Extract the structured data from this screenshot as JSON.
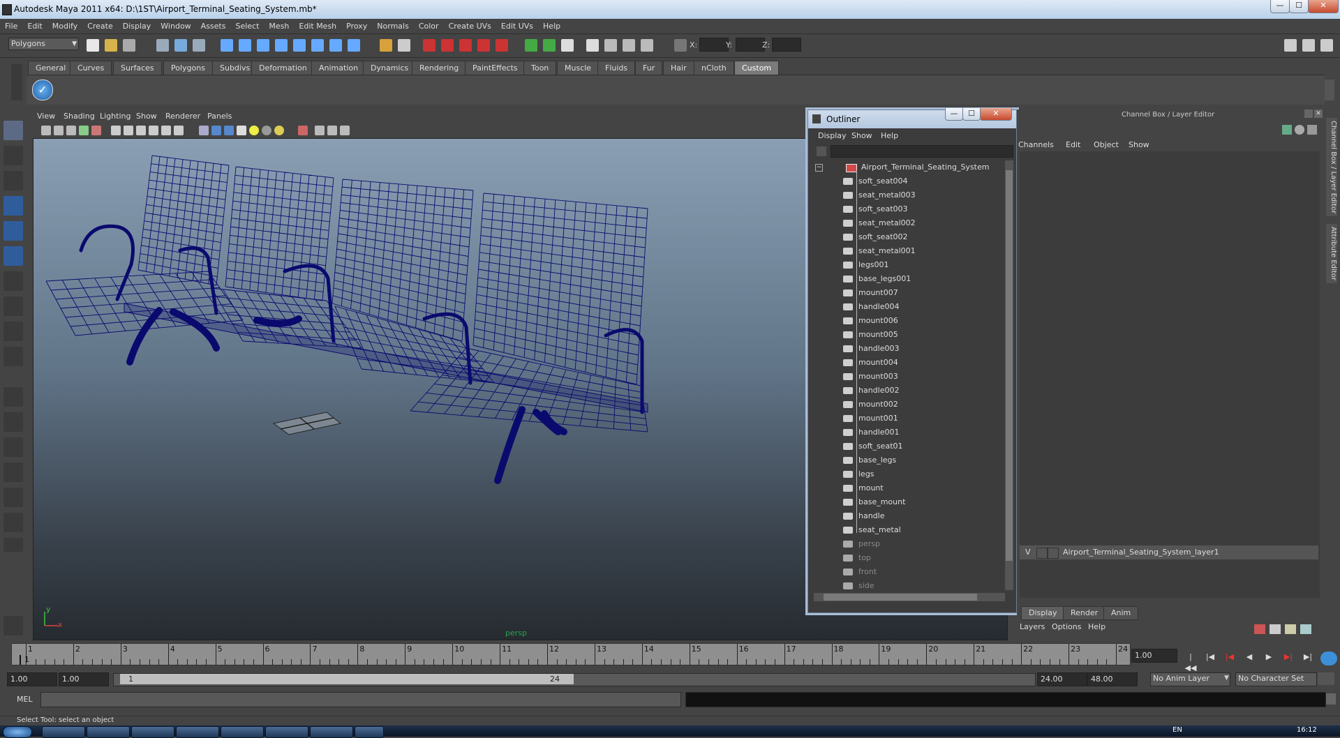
{
  "window": {
    "title": "Autodesk Maya 2011 x64: D:\\1ST\\Airport_Terminal_Seating_System.mb*",
    "min": "—",
    "max": "☐",
    "close": "✕"
  },
  "menubar": [
    "File",
    "Edit",
    "Modify",
    "Create",
    "Display",
    "Window",
    "Assets",
    "Select",
    "Mesh",
    "Edit Mesh",
    "Proxy",
    "Normals",
    "Color",
    "Create UVs",
    "Edit UVs",
    "Help"
  ],
  "statusline": {
    "mode": "Polygons",
    "x_label": "X:",
    "y_label": "Y:",
    "z_label": "Z:"
  },
  "shelf": {
    "tabs": [
      "General",
      "Curves",
      "Surfaces",
      "Polygons",
      "Subdivs",
      "Deformation",
      "Animation",
      "Dynamics",
      "Rendering",
      "PaintEffects",
      "Toon",
      "Muscle",
      "Fluids",
      "Fur",
      "Hair",
      "nCloth",
      "Custom"
    ],
    "active": "Custom"
  },
  "viewport": {
    "menu": [
      "View",
      "Shading",
      "Lighting",
      "Show",
      "Renderer",
      "Panels"
    ],
    "camera_label": "persp",
    "axis_x": "x",
    "axis_y": "y",
    "wire_color": "#0a0a6e"
  },
  "outliner": {
    "title": "Outliner",
    "menu": [
      "Display",
      "Show",
      "Help"
    ],
    "root": "Airport_Terminal_Seating_System",
    "children": [
      "soft_seat004",
      "seat_metal003",
      "soft_seat003",
      "seat_metal002",
      "soft_seat002",
      "seat_metal001",
      "legs001",
      "base_legs001",
      "mount007",
      "handle004",
      "mount006",
      "mount005",
      "handle003",
      "mount004",
      "mount003",
      "handle002",
      "mount002",
      "mount001",
      "handle001",
      "soft_seat01",
      "base_legs",
      "legs",
      "mount",
      "base_mount",
      "handle",
      "seat_metal"
    ],
    "cameras": [
      "persp",
      "top",
      "front",
      "side"
    ]
  },
  "channelbox": {
    "header": "Channel Box / Layer Editor",
    "menu": [
      "Channels",
      "Edit",
      "Object",
      "Show"
    ],
    "side_tabs": [
      "Channel Box / Layer Editor",
      "Attribute Editor"
    ]
  },
  "layereditor": {
    "tabs": [
      "Display",
      "Render",
      "Anim"
    ],
    "active_tab": "Display",
    "menu": [
      "Layers",
      "Options",
      "Help"
    ],
    "layer": {
      "visible": "V",
      "name": "Airport_Terminal_Seating_System_layer1"
    }
  },
  "timeline": {
    "ticks": [
      "1",
      "2",
      "3",
      "4",
      "5",
      "6",
      "7",
      "8",
      "9",
      "10",
      "11",
      "12",
      "13",
      "14",
      "15",
      "16",
      "17",
      "18",
      "19",
      "20",
      "21",
      "22",
      "23",
      "24"
    ],
    "current_frame": "1",
    "current_time": "1.00"
  },
  "range": {
    "start_time": "1.00",
    "playback_start": "1.00",
    "range_start_label": "1",
    "range_end_label": "24",
    "playback_end": "24.00",
    "end_time": "48.00",
    "anim_layer": "No Anim Layer",
    "char_set": "No Character Set"
  },
  "command": {
    "label": "MEL"
  },
  "help_line": "Select Tool: select an object",
  "taskbar": {
    "lang": "EN",
    "clock": "16:12"
  }
}
